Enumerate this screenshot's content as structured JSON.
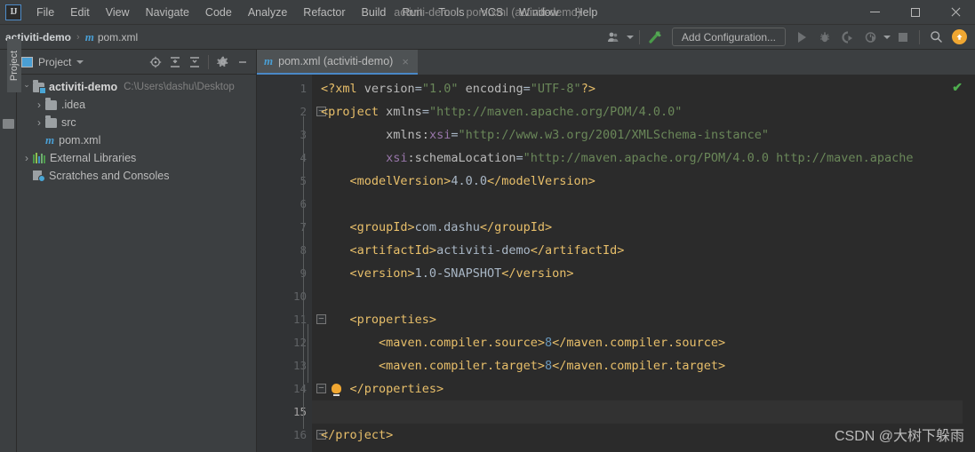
{
  "window": {
    "title": "activiti-demo - pom.xml (activiti-demo)",
    "logo": "IJ",
    "minimize": "minimize-button",
    "maximize": "maximize-button",
    "close": "close-button"
  },
  "menu": {
    "items": [
      {
        "label": "File"
      },
      {
        "label": "Edit"
      },
      {
        "label": "View"
      },
      {
        "label": "Navigate"
      },
      {
        "label": "Code"
      },
      {
        "label": "Analyze"
      },
      {
        "label": "Refactor"
      },
      {
        "label": "Build"
      },
      {
        "label": "Run"
      },
      {
        "label": "Tools"
      },
      {
        "label": "VCS"
      },
      {
        "label": "Window"
      },
      {
        "label": "Help"
      }
    ]
  },
  "navbar": {
    "project_name": "activiti-demo",
    "separator": "›",
    "file_icon": "m",
    "file_name": "pom.xml",
    "add_configuration": "Add Configuration...",
    "icons": {
      "user": "user-settings-icon",
      "build": "build-icon",
      "run": "run-icon",
      "debug": "debug-icon",
      "coverage": "run-with-coverage-icon",
      "profile": "profile-icon",
      "dropdown": "chevron-down-icon",
      "stop": "stop-icon",
      "search": "search-icon",
      "update": "update-available-icon"
    }
  },
  "sidebar": {
    "vertical_tab": "Project",
    "panel_title": "Project",
    "actions": [
      {
        "name": "select-opened-file-icon"
      },
      {
        "name": "expand-all-icon"
      },
      {
        "name": "collapse-all-icon"
      },
      {
        "name": "settings-gear-icon"
      },
      {
        "name": "hide-panel-icon"
      }
    ],
    "tree": [
      {
        "label": "activiti-demo",
        "path": "C:\\Users\\dashu\\Desktop",
        "icon": "module-folder-icon",
        "arrow": "open",
        "indent": 0,
        "bold": true
      },
      {
        "label": ".idea",
        "path": "",
        "icon": "folder-icon",
        "arrow": "closed",
        "indent": 1,
        "bold": false
      },
      {
        "label": "src",
        "path": "",
        "icon": "folder-icon",
        "arrow": "closed",
        "indent": 1,
        "bold": false
      },
      {
        "label": "pom.xml",
        "path": "",
        "icon": "maven-file-icon",
        "arrow": "none",
        "indent": 1,
        "bold": false
      },
      {
        "label": "External Libraries",
        "path": "",
        "icon": "libraries-icon",
        "arrow": "closed",
        "indent": 0,
        "bold": false
      },
      {
        "label": "Scratches and Consoles",
        "path": "",
        "icon": "scratches-icon",
        "arrow": "none",
        "indent": 0,
        "bold": false
      }
    ]
  },
  "editor": {
    "tab": {
      "label": "pom.xml (activiti-demo)",
      "icon": "m",
      "close": "×"
    },
    "inspection_status": "✔",
    "lines": [
      {
        "n": "1",
        "fold": false,
        "bulb": false,
        "caret": false,
        "spans": [
          {
            "t": "<?xml ",
            "c": "pi"
          },
          {
            "t": "version",
            "c": "attr"
          },
          {
            "t": "=",
            "c": "txt"
          },
          {
            "t": "\"1.0\"",
            "c": "str"
          },
          {
            "t": " ",
            "c": "txt"
          },
          {
            "t": "encoding",
            "c": "attr"
          },
          {
            "t": "=",
            "c": "txt"
          },
          {
            "t": "\"UTF-8\"",
            "c": "str"
          },
          {
            "t": "?>",
            "c": "pi"
          }
        ]
      },
      {
        "n": "2",
        "fold": true,
        "bulb": false,
        "caret": false,
        "spans": [
          {
            "t": "<project",
            "c": "tag"
          },
          {
            "t": " ",
            "c": "txt"
          },
          {
            "t": "xmlns",
            "c": "attr"
          },
          {
            "t": "=",
            "c": "txt"
          },
          {
            "t": "\"http://maven.apache.org/POM/4.0.0\"",
            "c": "str"
          }
        ]
      },
      {
        "n": "3",
        "fold": false,
        "bulb": false,
        "caret": false,
        "spans": [
          {
            "t": "         ",
            "c": "txt"
          },
          {
            "t": "xmlns:",
            "c": "attr"
          },
          {
            "t": "xsi",
            "c": "ns"
          },
          {
            "t": "=",
            "c": "txt"
          },
          {
            "t": "\"http://www.w3.org/2001/XMLSchema-instance\"",
            "c": "str"
          }
        ]
      },
      {
        "n": "4",
        "fold": false,
        "bulb": false,
        "caret": false,
        "spans": [
          {
            "t": "         ",
            "c": "txt"
          },
          {
            "t": "xsi",
            "c": "ns"
          },
          {
            "t": ":schemaLocation",
            "c": "attr"
          },
          {
            "t": "=",
            "c": "txt"
          },
          {
            "t": "\"http://maven.apache.org/POM/4.0.0 http://maven.apache",
            "c": "str"
          }
        ]
      },
      {
        "n": "5",
        "fold": false,
        "bulb": false,
        "caret": false,
        "spans": [
          {
            "t": "    ",
            "c": "txt"
          },
          {
            "t": "<modelVersion>",
            "c": "tag"
          },
          {
            "t": "4.0.0",
            "c": "txt"
          },
          {
            "t": "</modelVersion>",
            "c": "tag"
          }
        ]
      },
      {
        "n": "6",
        "fold": false,
        "bulb": false,
        "caret": false,
        "spans": []
      },
      {
        "n": "7",
        "fold": false,
        "bulb": false,
        "caret": false,
        "spans": [
          {
            "t": "    ",
            "c": "txt"
          },
          {
            "t": "<groupId>",
            "c": "tag"
          },
          {
            "t": "com.dashu",
            "c": "txt"
          },
          {
            "t": "</groupId>",
            "c": "tag"
          }
        ]
      },
      {
        "n": "8",
        "fold": false,
        "bulb": false,
        "caret": false,
        "spans": [
          {
            "t": "    ",
            "c": "txt"
          },
          {
            "t": "<artifactId>",
            "c": "tag"
          },
          {
            "t": "activiti-demo",
            "c": "txt"
          },
          {
            "t": "</artifactId>",
            "c": "tag"
          }
        ]
      },
      {
        "n": "9",
        "fold": false,
        "bulb": false,
        "caret": false,
        "spans": [
          {
            "t": "    ",
            "c": "txt"
          },
          {
            "t": "<version>",
            "c": "tag"
          },
          {
            "t": "1.0-SNAPSHOT",
            "c": "txt"
          },
          {
            "t": "</version>",
            "c": "tag"
          }
        ]
      },
      {
        "n": "10",
        "fold": false,
        "bulb": false,
        "caret": false,
        "spans": []
      },
      {
        "n": "11",
        "fold": true,
        "bulb": false,
        "caret": false,
        "spans": [
          {
            "t": "    ",
            "c": "txt"
          },
          {
            "t": "<properties>",
            "c": "tag"
          }
        ]
      },
      {
        "n": "12",
        "fold": false,
        "bulb": false,
        "caret": false,
        "spans": [
          {
            "t": "        ",
            "c": "txt"
          },
          {
            "t": "<maven.compiler.source>",
            "c": "tag"
          },
          {
            "t": "8",
            "c": "num"
          },
          {
            "t": "</maven.compiler.source>",
            "c": "tag"
          }
        ]
      },
      {
        "n": "13",
        "fold": false,
        "bulb": false,
        "caret": false,
        "spans": [
          {
            "t": "        ",
            "c": "txt"
          },
          {
            "t": "<maven.compiler.target>",
            "c": "tag"
          },
          {
            "t": "8",
            "c": "num"
          },
          {
            "t": "</maven.compiler.target>",
            "c": "tag"
          }
        ]
      },
      {
        "n": "14",
        "fold": true,
        "bulb": true,
        "caret": false,
        "spans": [
          {
            "t": "    ",
            "c": "txt"
          },
          {
            "t": "</properties>",
            "c": "tag"
          }
        ]
      },
      {
        "n": "15",
        "fold": false,
        "bulb": false,
        "caret": true,
        "spans": []
      },
      {
        "n": "16",
        "fold": true,
        "bulb": false,
        "caret": false,
        "spans": [
          {
            "t": "</project>",
            "c": "tag"
          }
        ]
      }
    ]
  },
  "watermark": "CSDN @大树下躲雨"
}
